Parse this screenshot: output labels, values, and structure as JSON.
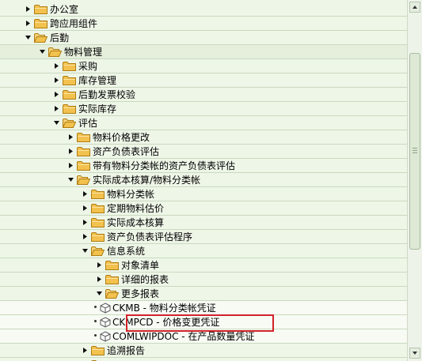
{
  "tree": [
    {
      "label": "办公室",
      "state": "collapsed",
      "indent": 0
    },
    {
      "label": "跨应用组件",
      "state": "collapsed",
      "indent": 0
    },
    {
      "label": "后勤",
      "state": "expanded",
      "indent": 0
    },
    {
      "label": "物料管理",
      "state": "expanded",
      "indent": 1
    },
    {
      "label": "采购",
      "state": "collapsed",
      "indent": 2
    },
    {
      "label": "库存管理",
      "state": "collapsed",
      "indent": 2
    },
    {
      "label": "后勤发票校验",
      "state": "collapsed",
      "indent": 2
    },
    {
      "label": "实际库存",
      "state": "collapsed",
      "indent": 2
    },
    {
      "label": "评估",
      "state": "expanded",
      "indent": 2
    },
    {
      "label": "物料价格更改",
      "state": "collapsed",
      "indent": 3
    },
    {
      "label": "资产负债表评估",
      "state": "collapsed",
      "indent": 3
    },
    {
      "label": "带有物料分类帐的资产负债表评估",
      "state": "collapsed",
      "indent": 3
    },
    {
      "label": "实际成本核算/物料分类帐",
      "state": "expanded",
      "indent": 3
    },
    {
      "label": "物料分类帐",
      "state": "collapsed",
      "indent": 4
    },
    {
      "label": "定期物料估价",
      "state": "collapsed",
      "indent": 4
    },
    {
      "label": "实际成本核算",
      "state": "collapsed",
      "indent": 4
    },
    {
      "label": "资产负债表评估程序",
      "state": "collapsed",
      "indent": 4
    },
    {
      "label": "信息系统",
      "state": "expanded",
      "indent": 4
    },
    {
      "label": "对象清单",
      "state": "collapsed",
      "indent": 5
    },
    {
      "label": "详细的报表",
      "state": "collapsed",
      "indent": 5
    },
    {
      "label": "更多报表",
      "state": "expanded",
      "indent": 5
    },
    {
      "label": "CKMB - 物料分类帐凭证",
      "state": "leaf",
      "indent": 6
    },
    {
      "label": "CKMPCD - 价格变更凭证",
      "state": "leaf",
      "indent": 6,
      "highlighted": true
    },
    {
      "label": "COMLWIPDOC - 在产品数量凭证",
      "state": "leaf",
      "indent": 6
    },
    {
      "label": "追溯报告",
      "state": "collapsed",
      "indent": 4
    },
    {
      "label": "",
      "state": "collapsed",
      "indent": 4
    }
  ],
  "colors": {
    "background": "#eef6e8",
    "folder": "#f2c14e",
    "folder_edge": "#b07d10",
    "highlight_border": "#d2232a"
  },
  "icons": {
    "collapsed": "triangle-right-icon",
    "expanded": "triangle-down-icon",
    "folder": "folder-icon",
    "leaf": "cube-icon"
  }
}
